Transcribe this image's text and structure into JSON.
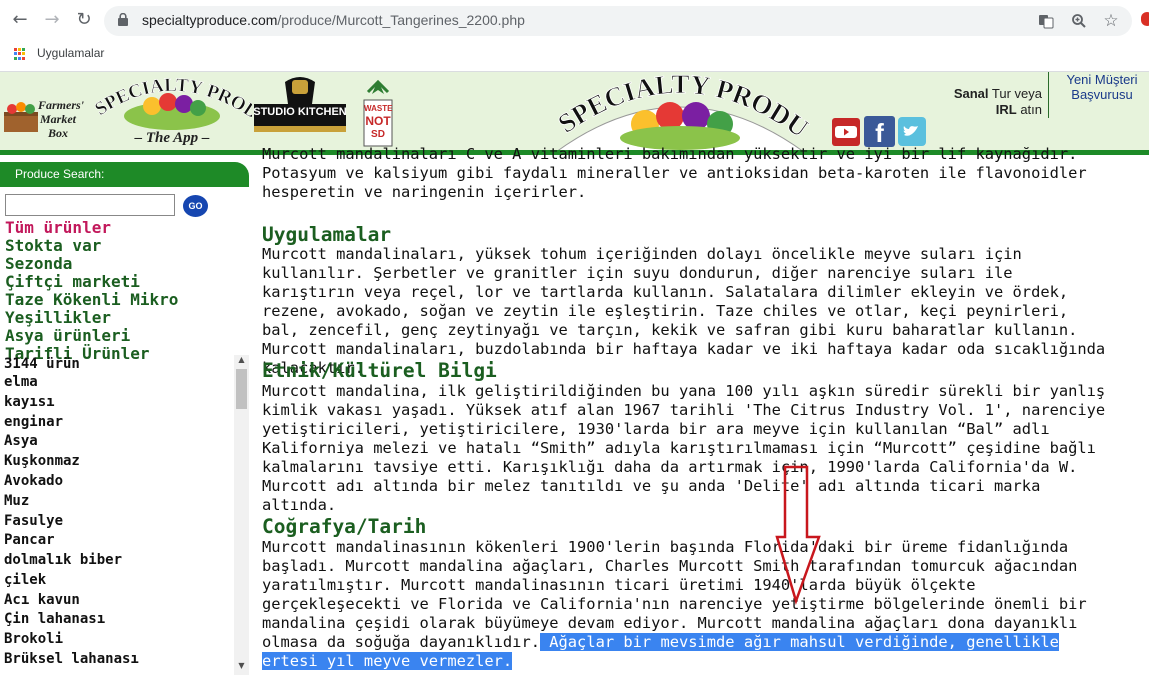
{
  "browser": {
    "url_domain": "specialtyproduce.com",
    "url_path": "/produce/Murcott_Tangerines_2200.php",
    "bookmark_apps_label": "Uygulamalar"
  },
  "header": {
    "logo_small": "SPECIALTY PRODUCE",
    "logo_app": "– The App –",
    "farmers_box": [
      "Farmers'",
      "Market",
      "Box"
    ],
    "studio_kitchen": "STUDIO KITCHEN",
    "waste_not": [
      "WASTE",
      "NOT",
      "SD"
    ],
    "logo_main": "SPECIALTY PRODUCE",
    "sanal_bold1": "Sanal",
    "sanal_text1": " Tur veya",
    "sanal_bold2": "IRL",
    "sanal_text2": " atın",
    "new_customer": "Yeni Müşteri Başvurusu",
    "social": [
      "YouTube",
      "Facebook",
      "Twitter"
    ]
  },
  "sidebar": {
    "search_label": "Produce Search:",
    "go_label": "GO",
    "categories": [
      "Tüm ürünler",
      "Stokta var",
      "Sezonda",
      "Çiftçi marketi",
      "Taze Kökenli Mikro",
      "Yeşillikler",
      "Asya ürünleri",
      "Tarifli Ürünler"
    ],
    "product_count": "3144 ürün",
    "products": [
      "elma",
      "kayısı",
      "enginar",
      "Asya",
      "Kuşkonmaz",
      "Avokado",
      "Muz",
      "Fasulye",
      "Pancar",
      "dolmalık biber",
      "çilek",
      "Acı kavun",
      "Çin lahanası",
      "Brokoli",
      "Brüksel lahanası"
    ]
  },
  "content": {
    "intro": "Murcott mandalinaları C ve A vitaminleri bakımından yüksektir ve iyi bir lif kaynağıdır. Potasyum ve kalsiyum gibi faydalı mineraller ve antioksidan beta-karoten ile flavonoidler hesperetin ve naringenin içerirler.",
    "s1_title": "Uygulamalar",
    "s1_text": "Murcott mandalinaları, yüksek tohum içeriğinden dolayı öncelikle meyve suları için kullanılır. Şerbetler ve granitler için suyu dondurun, diğer narenciye suları ile karıştırın veya reçel, lor ve tartlarda kullanın. Salatalara dilimler ekleyin ve ördek, rezene, avokado, soğan ve zeytin ile eşleştirin. Taze chiles ve otlar, keçi peynirleri, bal, zencefil, genç zeytinyağı ve tarçın, kekik ve safran gibi kuru baharatlar kullanın. Murcott mandalinaları, buzdolabında bir haftaya kadar ve iki haftaya kadar oda sıcaklığında kalacaktır.",
    "s2_title": "Etnik/Kültürel Bilgi",
    "s2_text": "Murcott mandalina, ilk geliştirildiğinden bu yana 100 yılı aşkın süredir sürekli bir yanlış kimlik vakası yaşadı. Yüksek atıf alan 1967 tarihli 'The Citrus Industry Vol. 1', narenciye yetiştiricileri, yetiştiricilere, 1930'larda bir ara meyve için kullanılan “Bal” adlı Kaliforniya melezi ve hatalı “Smith” adıyla karıştırılmaması için “Murcott” çeşidine bağlı kalmalarını tavsiye etti. Karışıklığı daha da artırmak için, 1990'larda California'da W. Murcott adı altında bir melez tanıtıldı ve şu anda 'Delite' adı altında ticari marka altında.",
    "s3_title": "Coğrafya/Tarih",
    "s3_text": "Murcott mandalinasının kökenleri 1900'lerin başında Florida'daki bir üreme fidanlığında başladı. Murcott mandalina ağaçları, Charles Murcott Smith tarafından tomurcuk ağacından yaratılmıştır. Murcott mandalinasının ticari üretimi 1940'larda büyük ölçekte gerçekleşecekti ve Florida ve California'nın narenciye yetiştirme bölgelerinde önemli bir mandalina çeşidi olarak büyümeye devam ediyor. Murcott mandalina ağaçları dona dayanıklı olmasa da soğuğa dayanıklıdır.",
    "s3_selected": " Ağaçlar bir mevsimde ağır mahsul verdiğinde, genellikle ertesi yıl meyve vermezler."
  },
  "colors": {
    "header_bg": "#e7f3dc",
    "brand_green": "#1e8a27",
    "heading_green": "#1b5e20",
    "selection": "#3a84f0",
    "arrow": "#c8171d"
  }
}
